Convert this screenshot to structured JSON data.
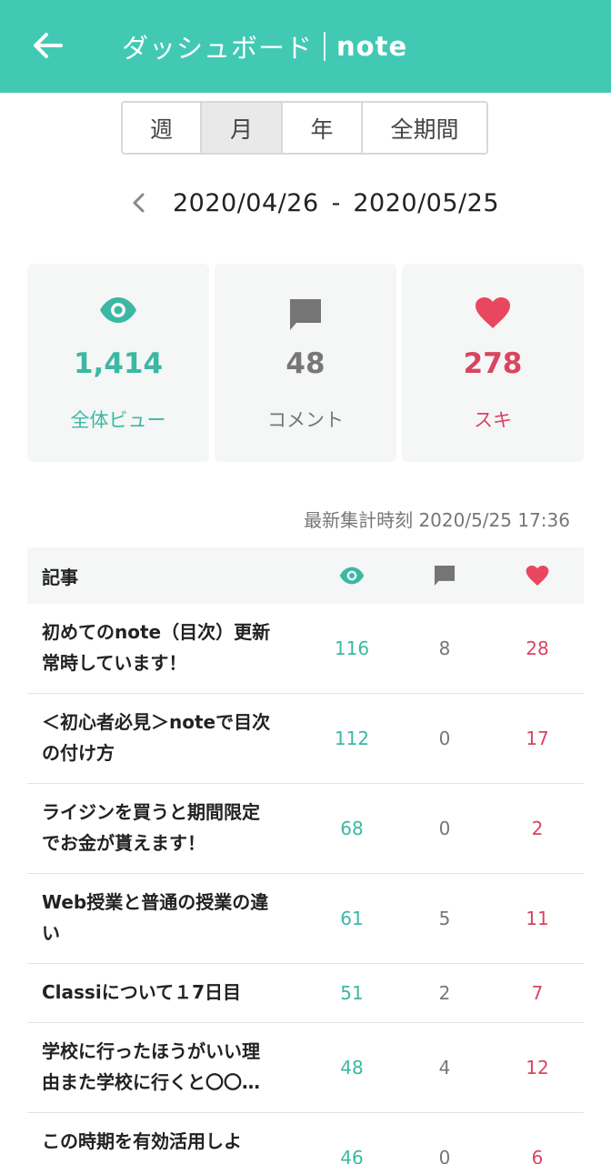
{
  "header": {
    "title": "ダッシュボード",
    "brand": "note",
    "colors": {
      "bar": "#41c9b4",
      "teal": "#3bb8a4",
      "red": "#d9455f",
      "gray": "#777777"
    }
  },
  "period_tabs": [
    {
      "label": "週"
    },
    {
      "label": "月",
      "active": true
    },
    {
      "label": "年"
    },
    {
      "label": "全期間"
    }
  ],
  "date_range": {
    "start": "2020/04/26",
    "separator": "-",
    "end": "2020/05/25"
  },
  "stats": {
    "views": {
      "value": "1,414",
      "label": "全体ビュー",
      "icon": "eye-icon"
    },
    "comments": {
      "value": "48",
      "label": "コメント",
      "icon": "comment-icon"
    },
    "likes": {
      "value": "278",
      "label": "スキ",
      "icon": "heart-icon"
    }
  },
  "updated": "最新集計時刻 2020/5/25 17:36",
  "table": {
    "header_label": "記事",
    "rows": [
      {
        "title_line1": "初めてのnote（目次）更新",
        "title_line2": "常時しています！",
        "views": "116",
        "comments": "8",
        "likes": "28"
      },
      {
        "title_line1": "＜初心者必見＞noteで目次",
        "title_line2": "の付け方",
        "views": "112",
        "comments": "0",
        "likes": "17"
      },
      {
        "title_line1": "ライジンを買うと期間限定",
        "title_line2": "でお金が貰えます！",
        "views": "68",
        "comments": "0",
        "likes": "2"
      },
      {
        "title_line1": "Web授業と普通の授業の違",
        "title_line2": "い",
        "views": "61",
        "comments": "5",
        "likes": "11"
      },
      {
        "title_line1": "Classiについて１7日目",
        "title_line2": "",
        "views": "51",
        "comments": "2",
        "likes": "7"
      },
      {
        "title_line1": "学校に行ったほうがいい理",
        "title_line2": "由また学校に行くと〇〇…",
        "views": "48",
        "comments": "4",
        "likes": "12"
      },
      {
        "title_line1": "この時期を有効活用しよ",
        "title_line2": "",
        "views": "46",
        "comments": "0",
        "likes": "6"
      }
    ]
  }
}
